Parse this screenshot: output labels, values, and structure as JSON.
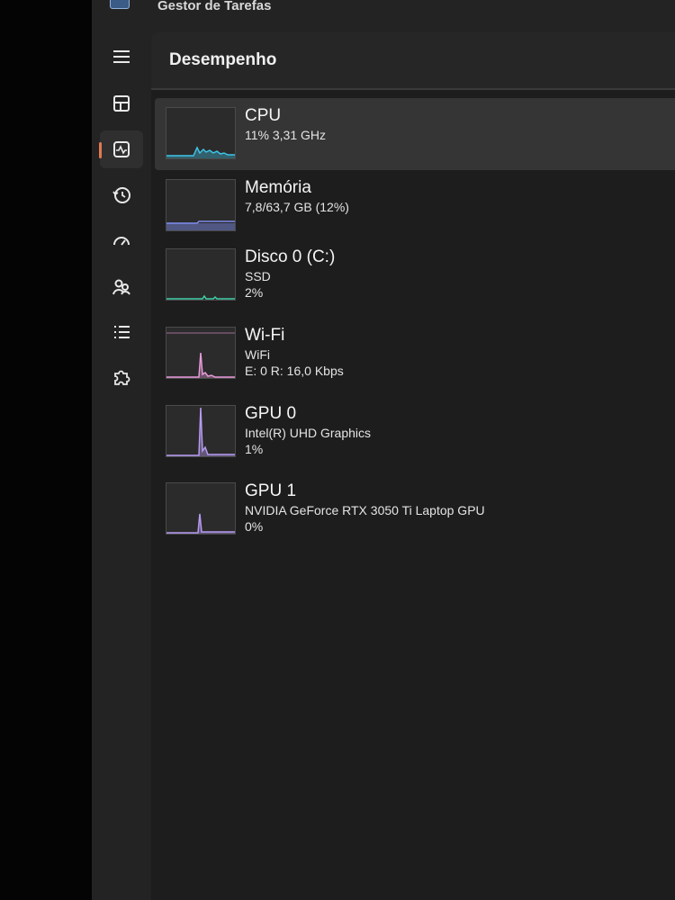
{
  "window": {
    "title": "Gestor de Tarefas"
  },
  "sidebar": {
    "items": [
      {
        "name": "menu",
        "icon": "hamburger-menu-icon"
      },
      {
        "name": "processes",
        "icon": "processes-icon"
      },
      {
        "name": "performance",
        "icon": "performance-icon",
        "active": true
      },
      {
        "name": "app-history",
        "icon": "history-icon"
      },
      {
        "name": "startup-apps",
        "icon": "speedometer-icon"
      },
      {
        "name": "users",
        "icon": "users-icon"
      },
      {
        "name": "details",
        "icon": "details-list-icon"
      },
      {
        "name": "services",
        "icon": "puzzle-icon"
      }
    ]
  },
  "header": {
    "title": "Desempenho"
  },
  "resources": [
    {
      "title": "CPU",
      "line1": "11%  3,31 GHz",
      "line2": "",
      "graph_color": "#3fc3e6",
      "selected": true
    },
    {
      "title": "Memória",
      "line1": "7,8/63,7 GB (12%)",
      "line2": "",
      "graph_color": "#7f8df0"
    },
    {
      "title": "Disco 0 (C:)",
      "line1": "SSD",
      "line2": "2%",
      "graph_color": "#3fd0a8"
    },
    {
      "title": "Wi-Fi",
      "line1": "WiFi",
      "line2": "E: 0  R: 16,0 Kbps",
      "graph_color": "#e79ad9"
    },
    {
      "title": "GPU 0",
      "line1": "Intel(R) UHD Graphics",
      "line2": "1%",
      "graph_color": "#b69af0"
    },
    {
      "title": "GPU 1",
      "line1": "NVIDIA GeForce RTX 3050 Ti Laptop GPU",
      "line2": "0%",
      "graph_color": "#b69af0"
    }
  ]
}
